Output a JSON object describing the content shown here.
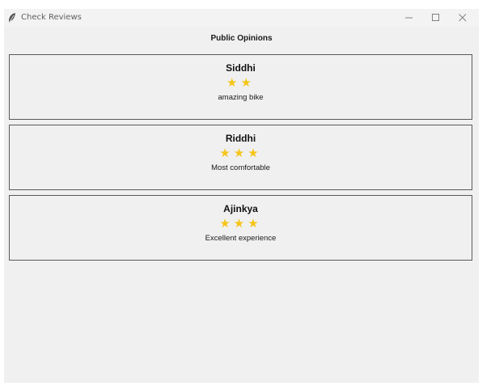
{
  "window": {
    "title": "Check Reviews",
    "icon": "feather-icon",
    "controls": [
      "minimize-icon",
      "maximize-icon",
      "close-icon"
    ]
  },
  "heading": "Public Opinions",
  "colors": {
    "star": "#f5c518",
    "background": "#f0f0f0",
    "card_border": "#5a5a5a"
  },
  "reviews": [
    {
      "name": "Siddhi",
      "rating": 2,
      "comment": "amazing bike"
    },
    {
      "name": "Riddhi",
      "rating": 3,
      "comment": "Most comfortable"
    },
    {
      "name": "Ajinkya",
      "rating": 3,
      "comment": "Excellent experience"
    }
  ]
}
